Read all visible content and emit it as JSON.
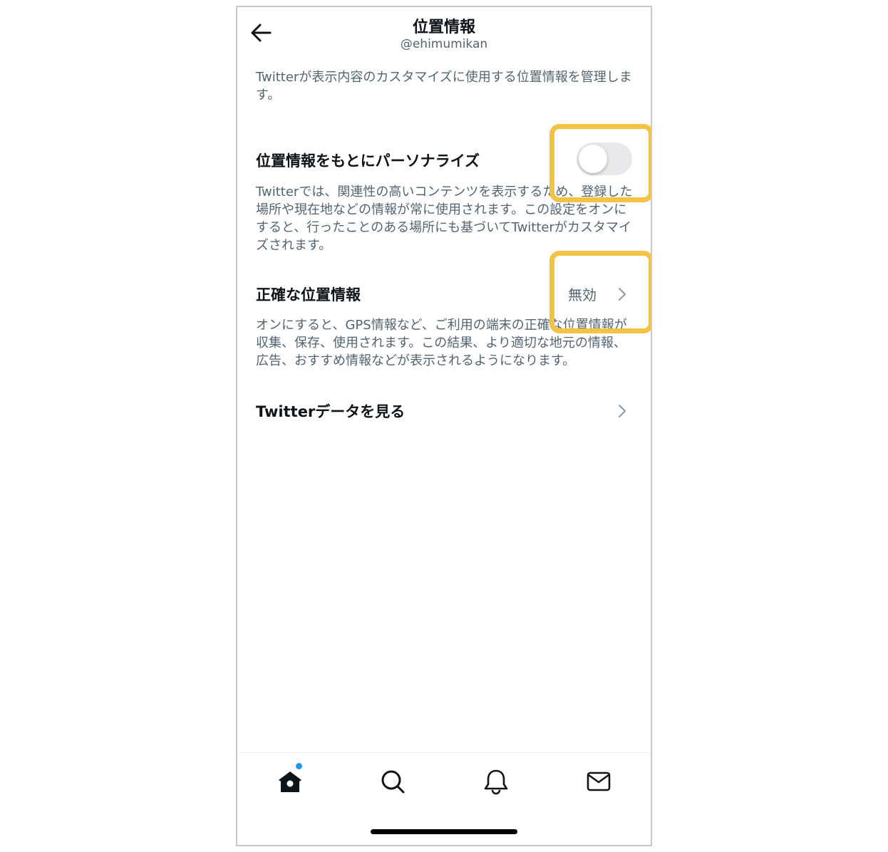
{
  "header": {
    "title": "位置情報",
    "username": "@ehimumikan",
    "back_icon": "arrow-left-icon"
  },
  "intro": {
    "text": "Twitterが表示内容のカスタマイズに使用する位置情報を管理します。"
  },
  "personalize": {
    "label": "位置情報をもとにパーソナライズ",
    "toggle_on": false,
    "description": "Twitterでは、関連性の高いコンテンツを表示するため、登録した場所や現在地などの情報が常に使用されます。この設定をオンにすると、行ったことのある場所にも基づいてTwitterがカスタマイズされます。"
  },
  "precise_location": {
    "label": "正確な位置情報",
    "value": "無効",
    "description": "オンにすると、GPS情報など、ご利用の端末の正確な位置情報が収集、保存、使用されます。この結果、より適切な地元の情報、広告、おすすめ情報などが表示されるようになります。"
  },
  "twitter_data": {
    "label": "Twitterデータを見る"
  },
  "tabbar": {
    "tabs": [
      "home-icon",
      "search-icon",
      "notifications-bell-icon",
      "messages-envelope-icon"
    ],
    "home_badge": true
  },
  "colors": {
    "highlight": "#f4c245",
    "toggle_off_track": "#e9e9eb",
    "secondary_text": "#536471",
    "badge": "#1d9bf0"
  }
}
